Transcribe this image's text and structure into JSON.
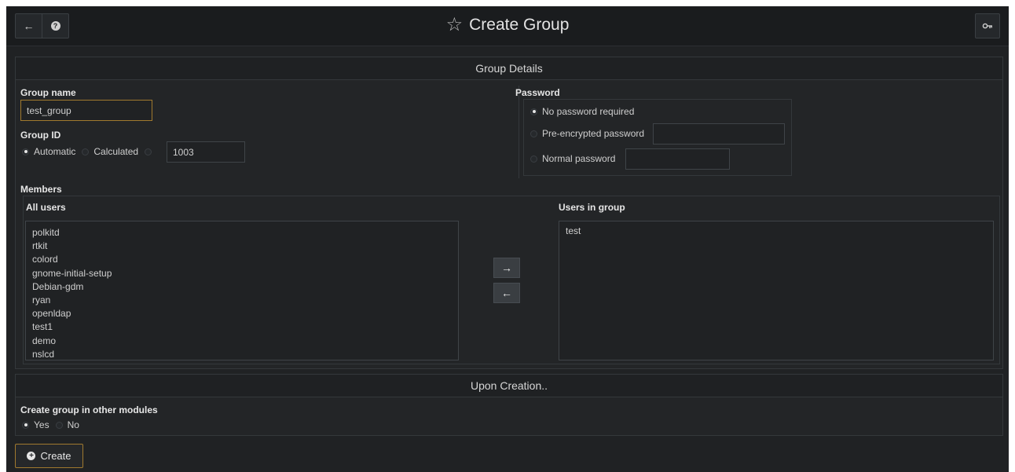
{
  "header": {
    "back_icon": "←",
    "help_icon": "?",
    "title_star_icon": "☆",
    "title": "Create Group",
    "key_icon": "key-icon"
  },
  "group_details": {
    "heading": "Group Details",
    "group_name_label": "Group name",
    "group_name_value": "test_group",
    "group_id_label": "Group ID",
    "group_id_options": {
      "automatic": "Automatic",
      "calculated": "Calculated"
    },
    "group_id_selected": "Automatic",
    "group_id_value": "1003",
    "password_label": "Password",
    "password_options": {
      "none": "No password required",
      "pre_encrypted": "Pre-encrypted password",
      "normal": "Normal password"
    },
    "password_selected": "No password required",
    "pre_encrypted_value": "",
    "normal_password_value": ""
  },
  "members": {
    "label": "Members",
    "all_users_label": "All users",
    "all_users": [
      "polkitd",
      "rtkit",
      "colord",
      "gnome-initial-setup",
      "Debian-gdm",
      "ryan",
      "openldap",
      "test1",
      "demo",
      "nslcd"
    ],
    "users_in_group_label": "Users in group",
    "users_in_group": [
      "test"
    ],
    "add_arrow": "→",
    "remove_arrow": "←"
  },
  "upon_creation": {
    "heading": "Upon Creation..",
    "other_modules_label": "Create group in other modules",
    "options": {
      "yes": "Yes",
      "no": "No"
    },
    "selected": "Yes"
  },
  "actions": {
    "create_label": "Create",
    "create_icon": "+"
  }
}
